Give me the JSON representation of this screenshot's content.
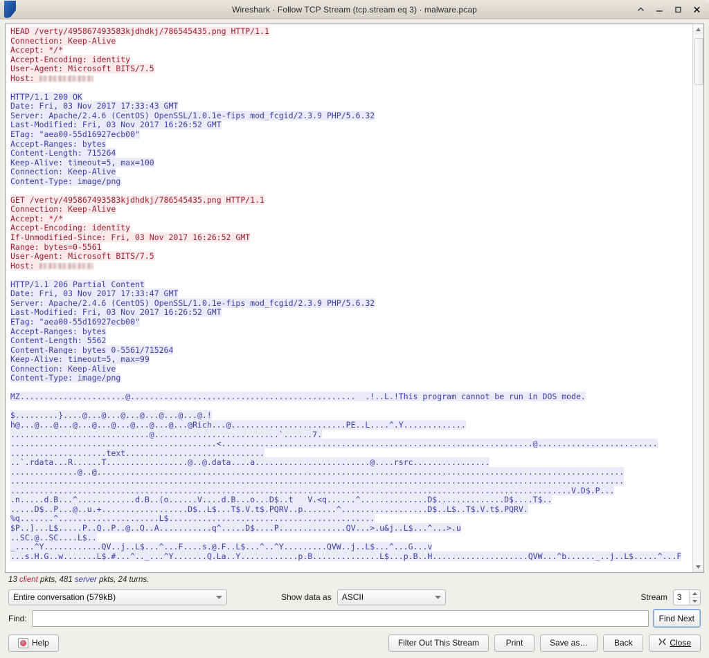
{
  "window": {
    "title": "Wireshark · Follow TCP Stream (tcp.stream eq 3) · malware.pcap",
    "controls": [
      {
        "name": "shade-icon",
        "label": "^"
      },
      {
        "name": "minimize-icon",
        "label": "–"
      },
      {
        "name": "maximize-icon",
        "label": "□"
      },
      {
        "name": "close-icon",
        "label": "✕"
      }
    ]
  },
  "colors": {
    "client_text": "#9c1f2e",
    "client_bg": "#fbeaec",
    "server_text": "#3b3fa8",
    "server_bg": "#eaeaf8",
    "window_bg": "#f0efec",
    "pane_bg": "#ffffff"
  },
  "stream": {
    "lines": [
      {
        "dir": "client",
        "text": "HEAD /verty/495867493583kjdhdkj/786545435.png HTTP/1.1"
      },
      {
        "dir": "client",
        "text": "Connection: Keep-Alive"
      },
      {
        "dir": "client",
        "text": "Accept: */*"
      },
      {
        "dir": "client",
        "text": "Accept-Encoding: identity"
      },
      {
        "dir": "client",
        "text": "User-Agent: Microsoft BITS/7.5"
      },
      {
        "dir": "client",
        "text": "Host: ",
        "redacted": 78
      },
      {
        "dir": "blank",
        "text": ""
      },
      {
        "dir": "server",
        "text": "HTTP/1.1 200 OK"
      },
      {
        "dir": "server",
        "text": "Date: Fri, 03 Nov 2017 17:33:43 GMT"
      },
      {
        "dir": "server",
        "text": "Server: Apache/2.4.6 (CentOS) OpenSSL/1.0.1e-fips mod_fcgid/2.3.9 PHP/5.6.32"
      },
      {
        "dir": "server",
        "text": "Last-Modified: Fri, 03 Nov 2017 16:26:52 GMT"
      },
      {
        "dir": "server",
        "text": "ETag: \"aea00-55d16927ecb00\""
      },
      {
        "dir": "server",
        "text": "Accept-Ranges: bytes"
      },
      {
        "dir": "server",
        "text": "Content-Length: 715264"
      },
      {
        "dir": "server",
        "text": "Keep-Alive: timeout=5, max=100"
      },
      {
        "dir": "server",
        "text": "Connection: Keep-Alive"
      },
      {
        "dir": "server",
        "text": "Content-Type: image/png"
      },
      {
        "dir": "blank",
        "text": ""
      },
      {
        "dir": "client",
        "text": "GET /verty/495867493583kjdhdkj/786545435.png HTTP/1.1"
      },
      {
        "dir": "client",
        "text": "Connection: Keep-Alive"
      },
      {
        "dir": "client",
        "text": "Accept: */*"
      },
      {
        "dir": "client",
        "text": "Accept-Encoding: identity"
      },
      {
        "dir": "client",
        "text": "If-Unmodified-Since: Fri, 03 Nov 2017 16:26:52 GMT"
      },
      {
        "dir": "client",
        "text": "Range: bytes=0-5561"
      },
      {
        "dir": "client",
        "text": "User-Agent: Microsoft BITS/7.5"
      },
      {
        "dir": "client",
        "text": "Host: ",
        "redacted": 78
      },
      {
        "dir": "blank",
        "text": ""
      },
      {
        "dir": "server",
        "text": "HTTP/1.1 206 Partial Content"
      },
      {
        "dir": "server",
        "text": "Date: Fri, 03 Nov 2017 17:33:47 GMT"
      },
      {
        "dir": "server",
        "text": "Server: Apache/2.4.6 (CentOS) OpenSSL/1.0.1e-fips mod_fcgid/2.3.9 PHP/5.6.32"
      },
      {
        "dir": "server",
        "text": "Last-Modified: Fri, 03 Nov 2017 16:26:52 GMT"
      },
      {
        "dir": "server",
        "text": "ETag: \"aea00-55d16927ecb00\""
      },
      {
        "dir": "server",
        "text": "Accept-Ranges: bytes"
      },
      {
        "dir": "server",
        "text": "Content-Length: 5562"
      },
      {
        "dir": "server",
        "text": "Content-Range: bytes 0-5561/715264"
      },
      {
        "dir": "server",
        "text": "Keep-Alive: timeout=5, max=99"
      },
      {
        "dir": "server",
        "text": "Connection: Keep-Alive"
      },
      {
        "dir": "server",
        "text": "Content-Type: image/png"
      },
      {
        "dir": "blank",
        "text": ""
      },
      {
        "dir": "server",
        "text": "MZ......................@...............................................  .!..L.!This program cannot be run in DOS mode."
      },
      {
        "dir": "blank",
        "text": ""
      },
      {
        "dir": "server",
        "text": "$.........}....@...@...@...@...@...@...@.!"
      },
      {
        "dir": "server",
        "text": "h@...@...@...@...@...@...@...@...@...@Rich...@........................PE..L....^.Y............."
      },
      {
        "dir": "server",
        "text": ".............................@..........................`......7."
      },
      {
        "dir": "server",
        "text": "...........................................<.................................................................@........................."
      },
      {
        "dir": "server",
        "text": "....................text............................."
      },
      {
        "dir": "server",
        "text": "..`.rdata...R......T.................@..@.data....a........................@....rsrc................"
      },
      {
        "dir": "server",
        "text": "..............@..@.............................................................................................................."
      },
      {
        "dir": "server",
        "text": "................................................................................................................................"
      },
      {
        "dir": "server",
        "text": ".....................................................................................................................V.D$.P..."
      },
      {
        "dir": "server",
        "text": ".n.....d.B...^............d.B..(o......V....d.B...o...D$..t   V.<q......^..............D$..............D$....T$.."
      },
      {
        "dir": "server",
        "text": ".....D$..P...@..u.+..................D$..L$...T$.V.t$.PQRV..p.......^..................D$..L$..T$.V.t$.PQRV."
      },
      {
        "dir": "server",
        "text": "%q.......^.....................L$..........................................."
      },
      {
        "dir": "server",
        "text": "$P..]...L$.....P..Q..P..@..Q..A...........q^.....D$....P..............QV...>.u&j..L$...^...>.u"
      },
      {
        "dir": "server",
        "text": "..SC.@..SC....L$.."
      },
      {
        "dir": "server",
        "text": "_....^Y............QV..j..L$...^...F....s.@.F..L$...^..^Y.........QVW..j..L$...^...G...v"
      },
      {
        "dir": "server",
        "text": "...s.H.G..w.......L$.#...^.._...^Y.......Q.La..Y............p.B..............L$...p.B..H....................QVW...^b......_..j..L$.....^...F"
      }
    ]
  },
  "status": {
    "prefix": "13 ",
    "client_word": "client",
    "middle": " pkts, 481 ",
    "server_word": "server",
    "suffix": " pkts, 24 turns."
  },
  "controls": {
    "conversation_value": "Entire conversation (579kB)",
    "show_data_as_label": "Show data as",
    "show_data_as_value": "ASCII",
    "stream_label": "Stream",
    "stream_value": "3",
    "find_label": "Find:",
    "find_value": "",
    "find_placeholder": "",
    "find_next_label": "Find Next"
  },
  "buttons": {
    "help": "Help",
    "filter_out": "Filter Out This Stream",
    "print": "Print",
    "save_as": "Save as…",
    "back": "Back",
    "close": "Close"
  }
}
